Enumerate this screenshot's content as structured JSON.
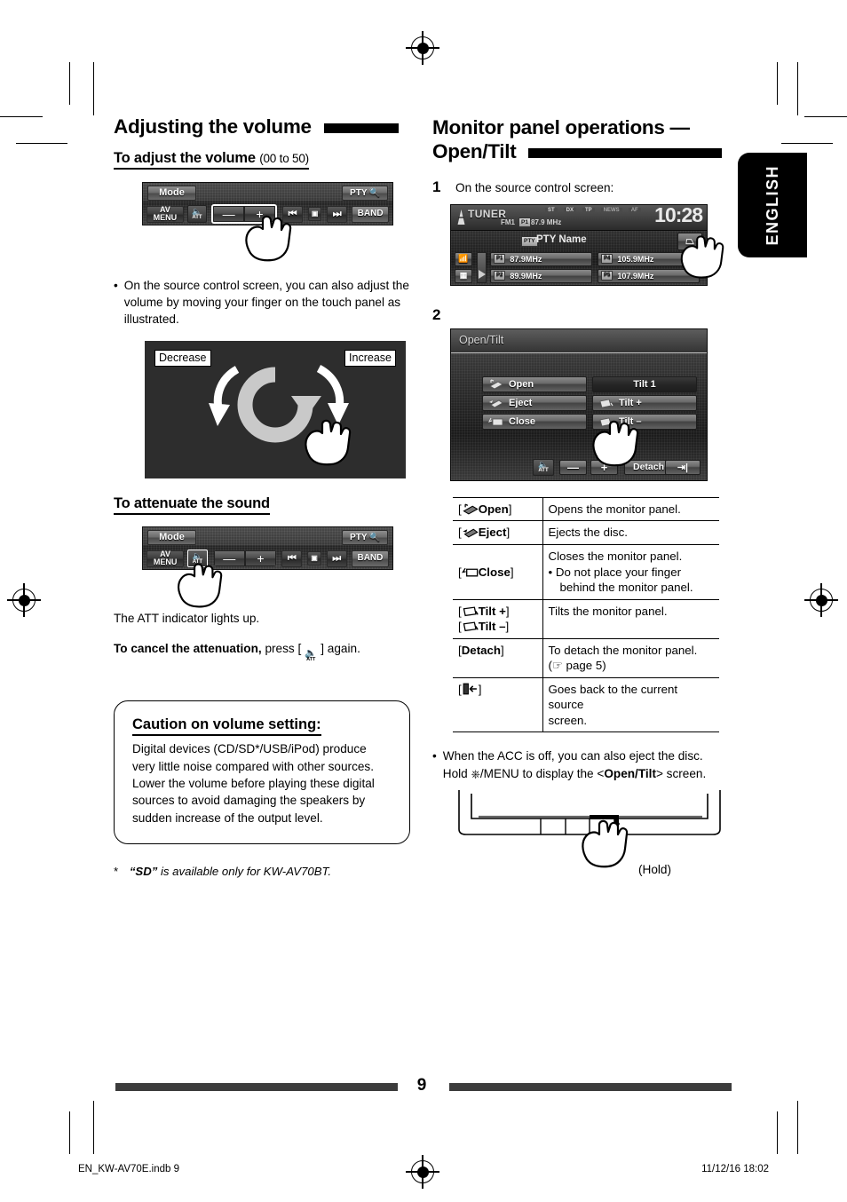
{
  "page": {
    "number": "9",
    "language_tab": "ENGLISH",
    "print_file": "EN_KW-AV70E.indb   9",
    "print_timestamp": "11/12/16   18:02"
  },
  "left_column": {
    "heading": "Adjusting the volume",
    "sub1": {
      "title": "To adjust the volume",
      "range": "(00 to 50)"
    },
    "faceplate1": {
      "mode": "Mode",
      "pty": "PTY",
      "av_menu": "AV MENU",
      "att": "ATT",
      "minus": "—",
      "plus": "+",
      "prev": "⏮",
      "next": "⏭",
      "band": "BAND"
    },
    "bullet1": "On the source control screen, you can also adjust the volume by moving your finger on the touch panel as illustrated.",
    "touchpanel": {
      "decrease": "Decrease",
      "increase": "Increase"
    },
    "sub2": {
      "title": "To attenuate the sound"
    },
    "att_text": "The ATT indicator lights up.",
    "cancel_bold": "To cancel the attenuation,",
    "cancel_rest_a": " press [",
    "cancel_rest_b": "] again.",
    "caution": {
      "title": "Caution on volume setting:",
      "body": "Digital devices (CD/SD*/USB/iPod) produce very little noise compared with other sources. Lower the volume before playing these digital sources to avoid damaging the speakers by sudden increase of the output level."
    },
    "footnote_star": "*",
    "footnote_quote": "“SD”",
    "footnote_rest": " is available only for KW-AV70BT."
  },
  "right_column": {
    "heading_line1": "Monitor panel operations —",
    "heading_line2": "Open/Tilt",
    "step1": {
      "num": "1",
      "text": "On the source control screen:"
    },
    "source_screen": {
      "source": "TUNER",
      "band": "FM1",
      "preset_tag": "P1",
      "freq": "87.9 MHz",
      "clock": "10:28",
      "indicators": [
        "ST",
        "DX",
        "TP",
        "NEWS",
        "AF"
      ],
      "pty_tag": "PTY",
      "pty_name": "PTY Name",
      "presets": [
        {
          "tag": "P1",
          "label": "87.9MHz"
        },
        {
          "tag": "P4",
          "label": "105.9MHz"
        },
        {
          "tag": "P2",
          "label": "89.9MHz"
        },
        {
          "tag": "P5",
          "label": "107.9MHz"
        }
      ]
    },
    "step2": {
      "num": "2"
    },
    "open_tilt_screen": {
      "title": "Open/Tilt",
      "buttons_left": [
        "Open",
        "Eject",
        "Close"
      ],
      "buttons_right": [
        "Tilt 1",
        "Tilt +",
        "Tilt –"
      ],
      "att": "ATT",
      "minus": "—",
      "plus": "+",
      "detach": "Detach"
    },
    "table": {
      "rows": [
        {
          "key": "Open",
          "key_bracket_icon": "open-panel-icon",
          "desc": [
            "Opens the monitor panel."
          ]
        },
        {
          "key": "Eject",
          "key_bracket_icon": "eject-panel-icon",
          "desc": [
            "Ejects the disc."
          ]
        },
        {
          "key": "Close",
          "key_bracket_icon": "close-panel-icon",
          "desc": [
            "Closes the monitor panel.",
            "•  Do not place your finger",
            "behind the monitor panel."
          ]
        },
        {
          "key": "Tilt +",
          "key2": "Tilt –",
          "key_bracket_icon": "tilt-panel-icon",
          "desc": [
            "Tilts the monitor panel."
          ]
        },
        {
          "key": "Detach",
          "key_bracket_icon": "",
          "desc": [
            "To detach the monitor panel.",
            "(☞ page 5)"
          ]
        },
        {
          "key": "",
          "key_bracket_icon": "return-icon",
          "desc": [
            "Goes back to the current source",
            "screen."
          ]
        }
      ]
    },
    "bullet_acc_a": "When the ACC is off, you can also eject the disc. Hold ",
    "bullet_acc_b": "/MENU to display the <",
    "bullet_acc_bold": "Open/Tilt",
    "bullet_acc_c": "> screen.",
    "hold_label": "(Hold)"
  },
  "colors": {
    "ink": "#000000",
    "rule": "#3c3c3c",
    "screen_dark": "#1b1b1b",
    "panel_gray": "#2d2d2d"
  }
}
